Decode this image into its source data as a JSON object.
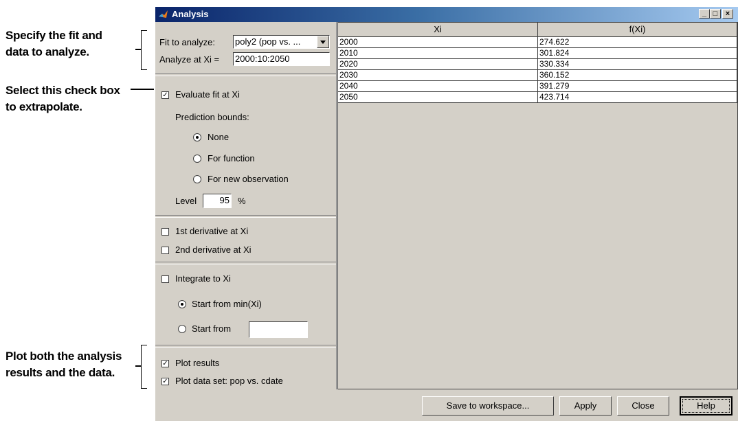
{
  "annotations": {
    "fit_data": [
      "Specify the fit and",
      "data to analyze."
    ],
    "extrapolate": [
      "Select this check box",
      "to extrapolate."
    ],
    "plot": [
      "Plot both the analysis",
      "results and the data."
    ]
  },
  "window": {
    "title": "Analysis",
    "icon": "matlab-icon",
    "controls": {
      "minimize": "_",
      "maximize": "□",
      "close": "×"
    }
  },
  "form": {
    "fit_label": "Fit to analyze:",
    "fit_value": "poly2 (pop vs. ...",
    "analyze_label": "Analyze at Xi =",
    "analyze_value": "2000:10:2050",
    "evaluate_label": "Evaluate fit at Xi",
    "evaluate_checked": true,
    "prediction_label": "Prediction bounds:",
    "prediction_options": [
      "None",
      "For function",
      "For new observation"
    ],
    "prediction_selected": "None",
    "level_label": "Level",
    "level_value": "95",
    "level_unit": "%",
    "deriv1_label": "1st derivative at Xi",
    "deriv1_checked": false,
    "deriv2_label": "2nd derivative at Xi",
    "deriv2_checked": false,
    "integrate_label": "Integrate to Xi",
    "integrate_checked": false,
    "start_min_label": "Start from min(Xi)",
    "start_from_label": "Start from",
    "start_from_value": "",
    "start_selected": "Start from min(Xi)",
    "plot_results_label": "Plot results",
    "plot_results_checked": true,
    "plot_data_label": "Plot data set: pop vs. cdate",
    "plot_data_checked": true
  },
  "table": {
    "columns": [
      "Xi",
      "f(Xi)"
    ],
    "rows": [
      [
        "2000",
        "274.622"
      ],
      [
        "2010",
        "301.824"
      ],
      [
        "2020",
        "330.334"
      ],
      [
        "2030",
        "360.152"
      ],
      [
        "2040",
        "391.279"
      ],
      [
        "2050",
        "423.714"
      ]
    ]
  },
  "buttons": {
    "save": "Save to workspace...",
    "apply": "Apply",
    "close": "Close",
    "help": "Help"
  }
}
